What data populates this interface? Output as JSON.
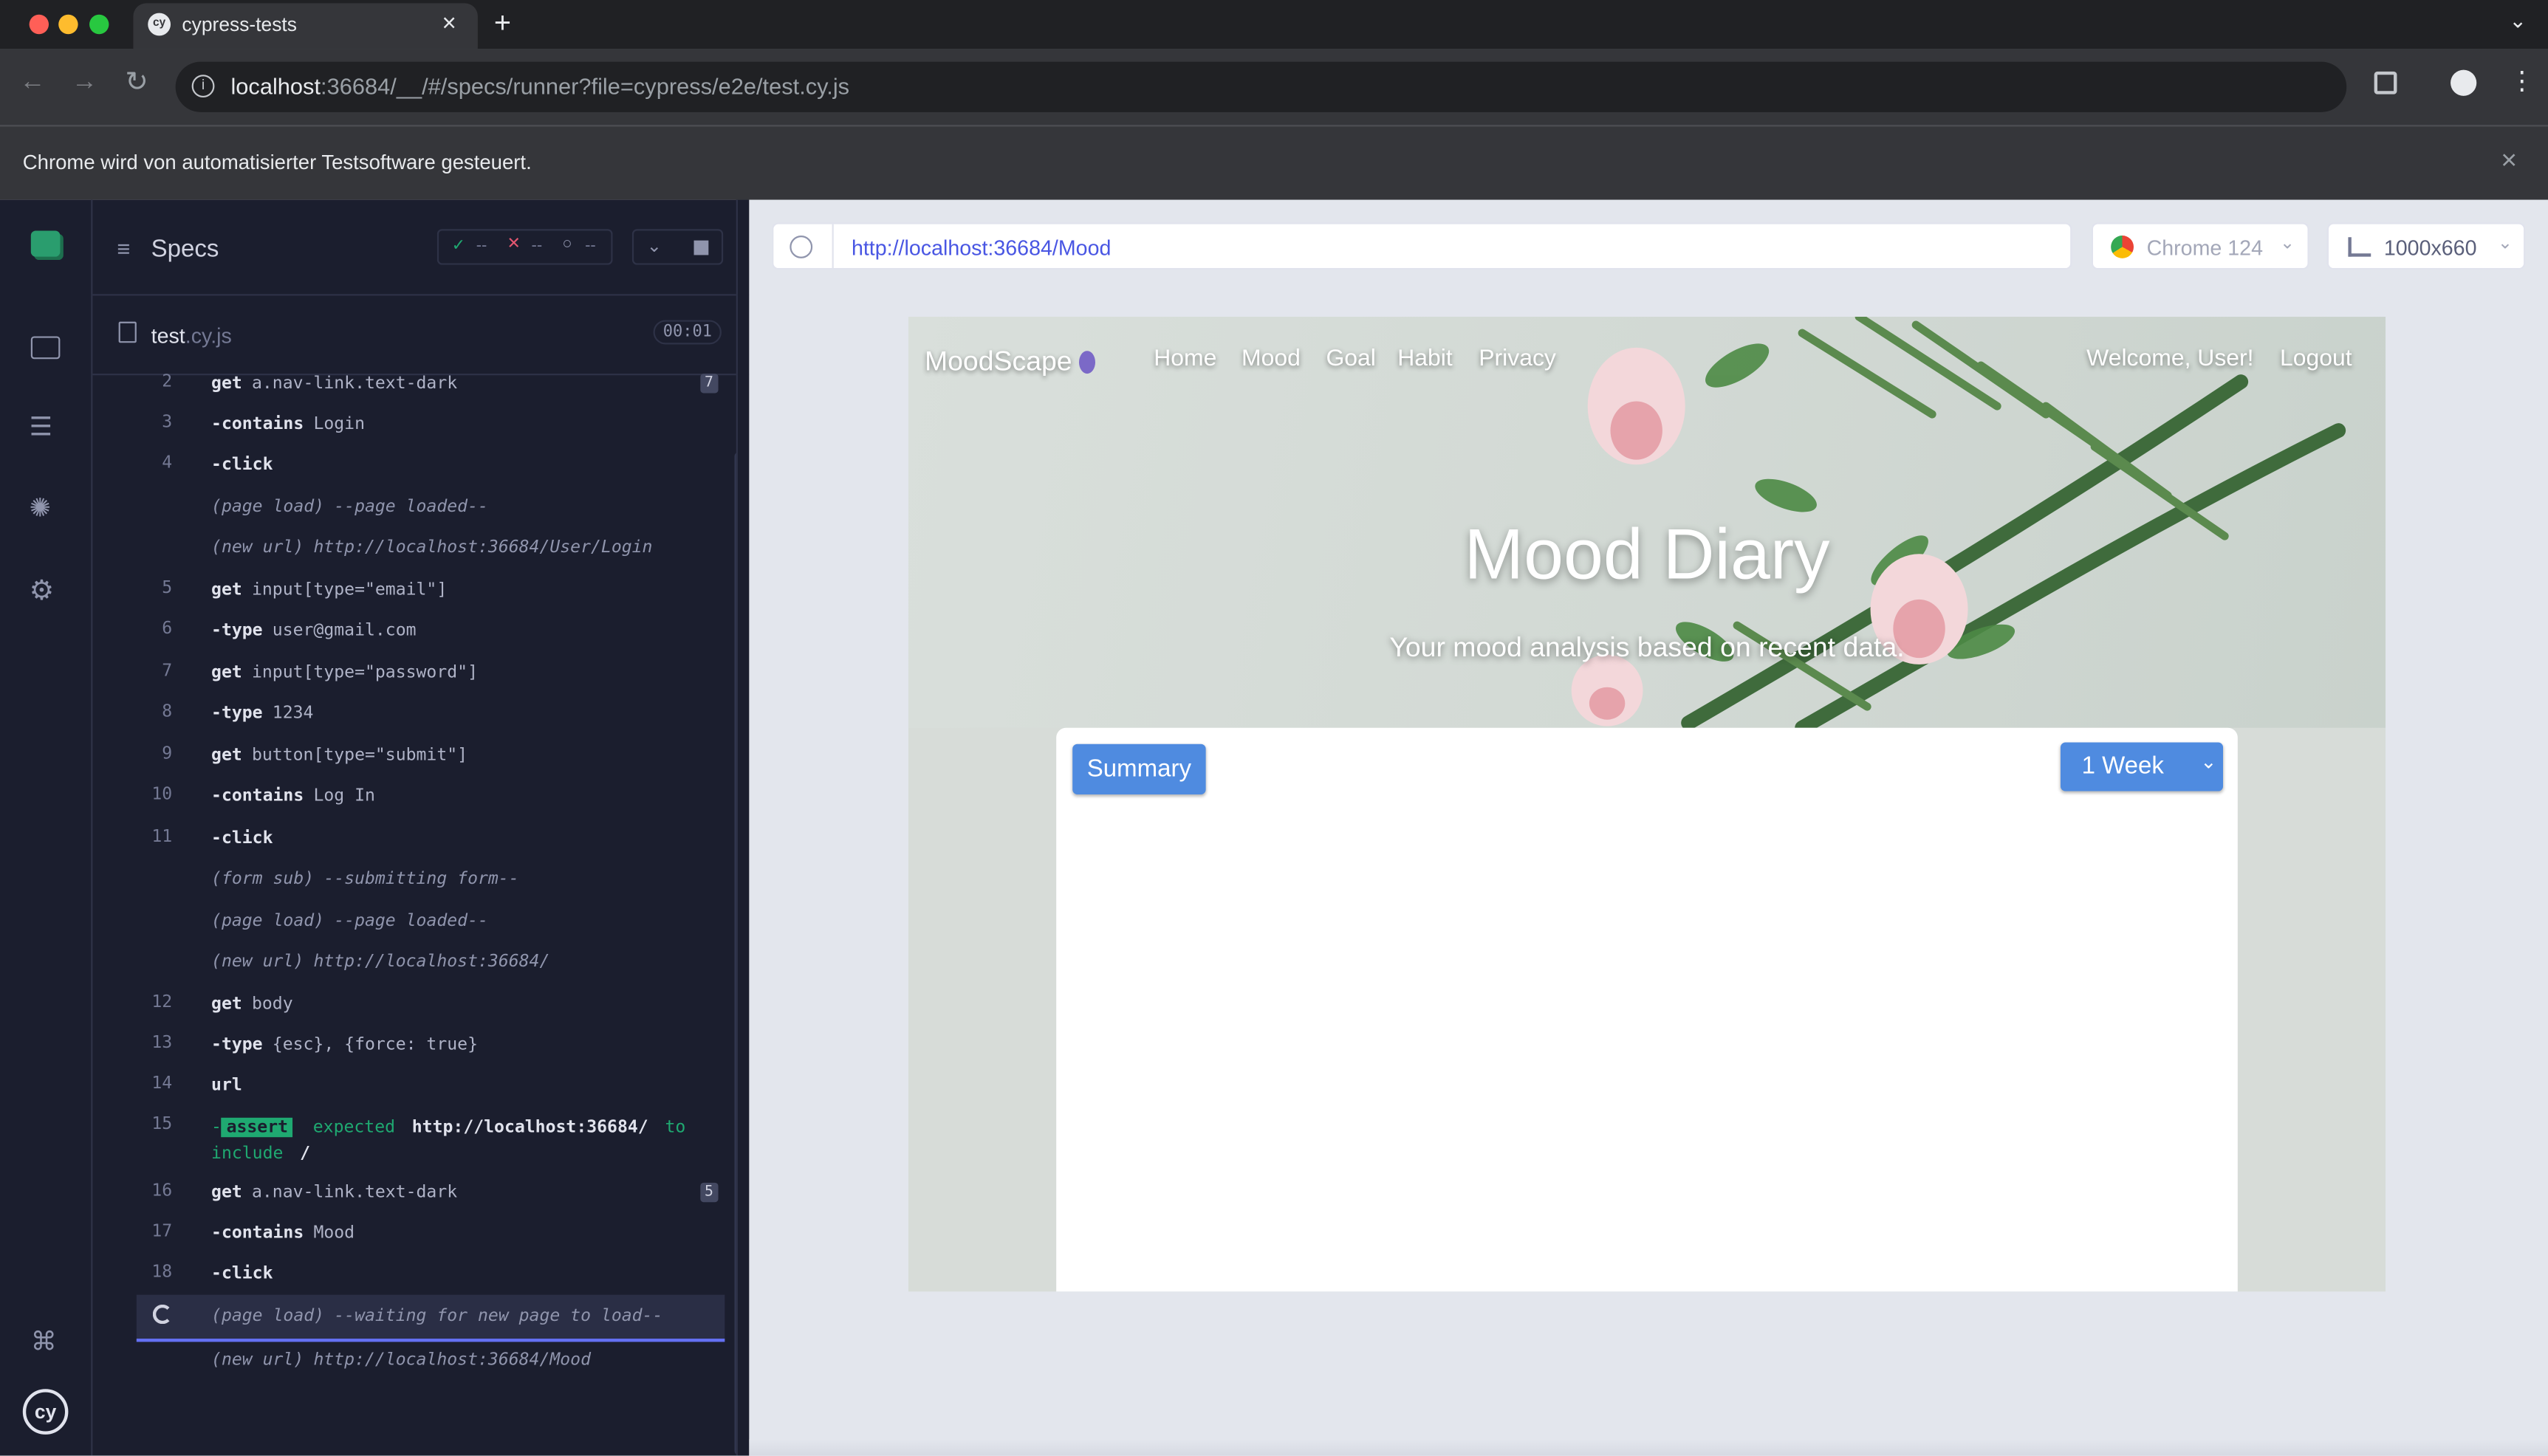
{
  "browser": {
    "tab_title": "cypress-tests",
    "url_host": "localhost",
    "url_rest": ":36684/__/#/specs/runner?file=cypress/e2e/test.cy.js",
    "infobar_text": "Chrome wird von automatisierter Testsoftware gesteuert."
  },
  "reporter": {
    "specs_label": "Specs",
    "passed": "--",
    "failed": "--",
    "pending": "--",
    "spec_name": "test",
    "spec_ext": ".cy.js",
    "duration": "00:01",
    "commands": [
      {
        "n": "2",
        "name": "get",
        "msg": "a.nav-link.text-dark",
        "badge": "7"
      },
      {
        "n": "3",
        "name": "-contains",
        "msg": "Login"
      },
      {
        "n": "4",
        "name": "-click",
        "msg": ""
      },
      {
        "n": "",
        "name": "(page load)",
        "msg": "--page loaded--",
        "italic": true
      },
      {
        "n": "",
        "name": "(new url)",
        "msg": "http://localhost:36684/User/Login",
        "italic": true
      },
      {
        "n": "5",
        "name": "get",
        "msg": "input[type=\"email\"]"
      },
      {
        "n": "6",
        "name": "-type",
        "msg": "user@gmail.com"
      },
      {
        "n": "7",
        "name": "get",
        "msg": "input[type=\"password\"]"
      },
      {
        "n": "8",
        "name": "-type",
        "msg": "1234"
      },
      {
        "n": "9",
        "name": "get",
        "msg": "button[type=\"submit\"]"
      },
      {
        "n": "10",
        "name": "-contains",
        "msg": "Log In"
      },
      {
        "n": "11",
        "name": "-click",
        "msg": ""
      },
      {
        "n": "",
        "name": "(form sub)",
        "msg": "--submitting form--",
        "italic": true
      },
      {
        "n": "",
        "name": "(page load)",
        "msg": "--page loaded--",
        "italic": true
      },
      {
        "n": "",
        "name": "(new url)",
        "msg": "http://localhost:36684/",
        "italic": true
      },
      {
        "n": "12",
        "name": "get",
        "msg": "body"
      },
      {
        "n": "13",
        "name": "-type",
        "msg": "{esc}, {force: true}"
      },
      {
        "n": "14",
        "name": "url",
        "msg": ""
      }
    ],
    "assert": {
      "n": "15",
      "dash": "-",
      "tag": "assert",
      "expected": "expected",
      "value": "http://localhost:36684/",
      "to": "to",
      "include": "include",
      "slash": "/"
    },
    "commands2": [
      {
        "n": "16",
        "name": "get",
        "msg": "a.nav-link.text-dark",
        "badge": "5"
      },
      {
        "n": "17",
        "name": "-contains",
        "msg": "Mood"
      },
      {
        "n": "18",
        "name": "-click",
        "msg": ""
      }
    ],
    "waiting": {
      "name": "(page load)",
      "msg": "--waiting for new page to load--"
    },
    "last": {
      "name": "(new url)",
      "msg": "http://localhost:36684/Mood"
    }
  },
  "aut": {
    "url": "http://localhost:36684/Mood",
    "browser_label": "Chrome 124",
    "viewport_label": "1000x660"
  },
  "app": {
    "brand": "MoodScape",
    "nav": [
      "Home",
      "Mood",
      "Goal",
      "Habit",
      "Privacy"
    ],
    "welcome": "Welcome, User!",
    "logout": "Logout",
    "title": "Mood Diary",
    "subtitle": "Your mood analysis based on recent data.",
    "summary_button": "Summary",
    "range_select": "1 Week"
  },
  "colors": {
    "accent": "#4f8be0",
    "cypress_bg": "#1b1e2e",
    "pass": "#1fa971",
    "fail": "#e45770",
    "assert_bg": "#1fa971"
  }
}
